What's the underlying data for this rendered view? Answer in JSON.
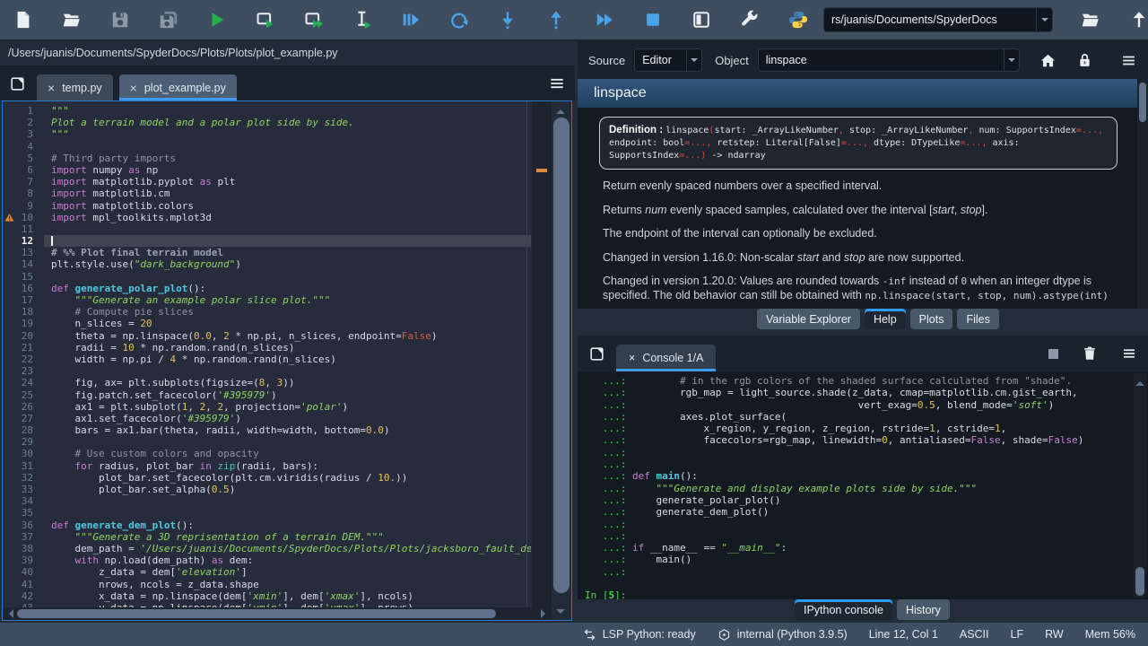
{
  "toolbar": {
    "workdir_value": "rs/juanis/Documents/SpyderDocs",
    "buttons": [
      "new-file",
      "open-file",
      "save",
      "save-all",
      "run-file",
      "run-cell",
      "run-cell-and-advance",
      "run-selection",
      "debug-file",
      "re-run-cell",
      "step-into",
      "step-return",
      "continue",
      "stop",
      "maximize-pane",
      "preferences",
      "python-logo"
    ],
    "right_buttons": [
      "browse-working-directory",
      "parent-directory"
    ]
  },
  "accent": "#3f9bf0",
  "editor": {
    "path": "/Users/juanis/Documents/SpyderDocs/Plots/Plots/plot_example.py",
    "tabs": [
      {
        "label": "temp.py",
        "active": false
      },
      {
        "label": "plot_example.py",
        "active": true
      }
    ],
    "lines": [
      {
        "n": 1,
        "segs": [
          [
            "s",
            "\"\"\""
          ]
        ]
      },
      {
        "n": 2,
        "segs": [
          [
            "s",
            "Plot a terrain model and a polar plot side by side."
          ]
        ]
      },
      {
        "n": 3,
        "segs": [
          [
            "s",
            "\"\"\""
          ]
        ]
      },
      {
        "n": 4,
        "segs": []
      },
      {
        "n": 5,
        "segs": [
          [
            "c",
            "# Third party imports"
          ]
        ]
      },
      {
        "n": 6,
        "segs": [
          [
            "kw",
            "import"
          ],
          [
            "t",
            " numpy "
          ],
          [
            "kw",
            "as"
          ],
          [
            "t",
            " np"
          ]
        ]
      },
      {
        "n": 7,
        "segs": [
          [
            "kw",
            "import"
          ],
          [
            "t",
            " matplotlib.pyplot "
          ],
          [
            "kw",
            "as"
          ],
          [
            "t",
            " plt"
          ]
        ]
      },
      {
        "n": 8,
        "segs": [
          [
            "kw",
            "import"
          ],
          [
            "t",
            " matplotlib.cm"
          ]
        ]
      },
      {
        "n": 9,
        "segs": [
          [
            "kw",
            "import"
          ],
          [
            "t",
            " matplotlib.colors"
          ]
        ]
      },
      {
        "n": 10,
        "warn": true,
        "segs": [
          [
            "kw",
            "import"
          ],
          [
            "t",
            " mpl_toolkits.mplot3d"
          ]
        ]
      },
      {
        "n": 11,
        "segs": []
      },
      {
        "n": 12,
        "cur": true,
        "segs": []
      },
      {
        "n": 13,
        "segs": [
          [
            "cc",
            "# %% Plot final terrain model"
          ]
        ]
      },
      {
        "n": 14,
        "segs": [
          [
            "t",
            "plt.style.use("
          ],
          [
            "s",
            "\"dark_background\""
          ],
          [
            "t",
            ")"
          ]
        ]
      },
      {
        "n": 15,
        "segs": []
      },
      {
        "n": 16,
        "segs": [
          [
            "kw",
            "def"
          ],
          [
            "t",
            " "
          ],
          [
            "d",
            "generate_polar_plot"
          ],
          [
            "t",
            "():"
          ]
        ]
      },
      {
        "n": 17,
        "segs": [
          [
            "t",
            "    "
          ],
          [
            "s",
            "\"\"\"Generate an example polar slice plot.\"\"\""
          ]
        ]
      },
      {
        "n": 18,
        "segs": [
          [
            "t",
            "    "
          ],
          [
            "c",
            "# Compute pie slices"
          ]
        ]
      },
      {
        "n": 19,
        "segs": [
          [
            "t",
            "    n_slices = "
          ],
          [
            "n",
            "20"
          ]
        ]
      },
      {
        "n": 20,
        "segs": [
          [
            "t",
            "    theta = np.linspace("
          ],
          [
            "n",
            "0.0"
          ],
          [
            "t",
            ", "
          ],
          [
            "n",
            "2"
          ],
          [
            "t",
            " * np.pi, n_slices, endpoint="
          ],
          [
            "f",
            "False"
          ],
          [
            "t",
            ")"
          ]
        ]
      },
      {
        "n": 21,
        "segs": [
          [
            "t",
            "    radii = "
          ],
          [
            "n",
            "10"
          ],
          [
            "t",
            " * np.random.rand(n_slices)"
          ]
        ]
      },
      {
        "n": 22,
        "segs": [
          [
            "t",
            "    width = np.pi / "
          ],
          [
            "n",
            "4"
          ],
          [
            "t",
            " * np.random.rand(n_slices)"
          ]
        ]
      },
      {
        "n": 23,
        "segs": []
      },
      {
        "n": 24,
        "segs": [
          [
            "t",
            "    fig, ax= plt.subplots(figsize=("
          ],
          [
            "n",
            "8"
          ],
          [
            "t",
            ", "
          ],
          [
            "n",
            "3"
          ],
          [
            "t",
            "))"
          ]
        ]
      },
      {
        "n": 25,
        "segs": [
          [
            "t",
            "    fig.patch.set_facecolor("
          ],
          [
            "s",
            "'#395979'"
          ],
          [
            "t",
            ")"
          ]
        ]
      },
      {
        "n": 26,
        "segs": [
          [
            "t",
            "    ax1 = plt.subplot("
          ],
          [
            "n",
            "1"
          ],
          [
            "t",
            ", "
          ],
          [
            "n",
            "2"
          ],
          [
            "t",
            ", "
          ],
          [
            "n",
            "2"
          ],
          [
            "t",
            ", projection="
          ],
          [
            "s",
            "'polar'"
          ],
          [
            "t",
            ")"
          ]
        ]
      },
      {
        "n": 27,
        "segs": [
          [
            "t",
            "    ax1.set_facecolor("
          ],
          [
            "s",
            "'#395979'"
          ],
          [
            "t",
            ")"
          ]
        ]
      },
      {
        "n": 28,
        "segs": [
          [
            "t",
            "    bars = ax1.bar(theta, radii, width=width, bottom="
          ],
          [
            "n",
            "0.0"
          ],
          [
            "t",
            ")"
          ]
        ]
      },
      {
        "n": 29,
        "segs": []
      },
      {
        "n": 30,
        "segs": [
          [
            "t",
            "    "
          ],
          [
            "c",
            "# Use custom colors and opacity"
          ]
        ]
      },
      {
        "n": 31,
        "segs": [
          [
            "t",
            "    "
          ],
          [
            "kw",
            "for"
          ],
          [
            "t",
            " radius, plot_bar "
          ],
          [
            "kw",
            "in"
          ],
          [
            "t",
            " "
          ],
          [
            "b",
            "zip"
          ],
          [
            "t",
            "(radii, bars):"
          ]
        ]
      },
      {
        "n": 32,
        "segs": [
          [
            "t",
            "        plot_bar.set_facecolor(plt.cm.viridis(radius / "
          ],
          [
            "n",
            "10."
          ],
          [
            "t",
            "))"
          ]
        ]
      },
      {
        "n": 33,
        "segs": [
          [
            "t",
            "        plot_bar.set_alpha("
          ],
          [
            "n",
            "0.5"
          ],
          [
            "t",
            ")"
          ]
        ]
      },
      {
        "n": 34,
        "segs": []
      },
      {
        "n": 35,
        "segs": []
      },
      {
        "n": 36,
        "segs": [
          [
            "kw",
            "def"
          ],
          [
            "t",
            " "
          ],
          [
            "d",
            "generate_dem_plot"
          ],
          [
            "t",
            "():"
          ]
        ]
      },
      {
        "n": 37,
        "segs": [
          [
            "t",
            "    "
          ],
          [
            "s",
            "\"\"\"Generate a 3D reprisentation of a terrain DEM.\"\"\""
          ]
        ]
      },
      {
        "n": 38,
        "segs": [
          [
            "t",
            "    dem_path = "
          ],
          [
            "s",
            "'/Users/juanis/Documents/SpyderDocs/Plots/Plots/jacksboro_fault_dem.npz'"
          ]
        ]
      },
      {
        "n": 39,
        "segs": [
          [
            "t",
            "    "
          ],
          [
            "kw",
            "with"
          ],
          [
            "t",
            " np.load(dem_path) "
          ],
          [
            "kw",
            "as"
          ],
          [
            "t",
            " dem:"
          ]
        ]
      },
      {
        "n": 40,
        "segs": [
          [
            "t",
            "        z_data = dem["
          ],
          [
            "s",
            "'elevation'"
          ],
          [
            "t",
            "]"
          ]
        ]
      },
      {
        "n": 41,
        "segs": [
          [
            "t",
            "        nrows, ncols = z_data.shape"
          ]
        ]
      },
      {
        "n": 42,
        "segs": [
          [
            "t",
            "        x_data = np.linspace(dem["
          ],
          [
            "s",
            "'xmin'"
          ],
          [
            "t",
            "], dem["
          ],
          [
            "s",
            "'xmax'"
          ],
          [
            "t",
            "], ncols)"
          ]
        ]
      },
      {
        "n": 43,
        "segs": [
          [
            "t",
            "        y_data = np.linspace(dem["
          ],
          [
            "s",
            "'ymin'"
          ],
          [
            "t",
            "], dem["
          ],
          [
            "s",
            "'ymax'"
          ],
          [
            "t",
            "], nrows)"
          ]
        ]
      }
    ]
  },
  "help": {
    "source_label": "Source",
    "source_value": "Editor",
    "object_label": "Object",
    "object_value": "linspace",
    "title": "linspace",
    "definition": [
      [
        "lab",
        "Definition : "
      ],
      [
        "w",
        "linspace"
      ],
      [
        "r",
        "("
      ],
      [
        "w",
        "start: _ArrayLikeNumber"
      ],
      [
        "r",
        ", "
      ],
      [
        "w",
        "stop: _ArrayLikeNumber"
      ],
      [
        "r",
        ", "
      ],
      [
        "w",
        "num: SupportsIndex"
      ],
      [
        "r",
        "=..., "
      ],
      [
        "w",
        "endpoint: bool"
      ],
      [
        "r",
        "=..., "
      ],
      [
        "w",
        "retstep: Literal[False]"
      ],
      [
        "r",
        "=..., "
      ],
      [
        "w",
        "dtype: DTypeLike"
      ],
      [
        "r",
        "=..., "
      ],
      [
        "w",
        "axis: SupportsIndex"
      ],
      [
        "r",
        "=...)"
      ],
      [
        "w",
        " -> ndarray"
      ]
    ],
    "paragraphs": [
      [
        [
          "t",
          "Return evenly spaced numbers over a specified interval."
        ]
      ],
      [
        [
          "t",
          "Returns "
        ],
        [
          "i",
          "num"
        ],
        [
          "t",
          " evenly spaced samples, calculated over the interval ["
        ],
        [
          "i",
          "start"
        ],
        [
          "t",
          ", "
        ],
        [
          "i",
          "stop"
        ],
        [
          "t",
          "]."
        ]
      ],
      [
        [
          "t",
          "The endpoint of the interval can optionally be excluded."
        ]
      ],
      [
        [
          "t",
          "Changed in version 1.16.0: Non-scalar "
        ],
        [
          "i",
          "start"
        ],
        [
          "t",
          " and "
        ],
        [
          "i",
          "stop"
        ],
        [
          "t",
          " are now supported."
        ]
      ],
      [
        [
          "t",
          "Changed in version 1.20.0: Values are rounded towards "
        ],
        [
          "m",
          "-inf"
        ],
        [
          "t",
          " instead of "
        ],
        [
          "m",
          "0"
        ],
        [
          "t",
          " when an integer dtype is specified. The old behavior can still be obtained with "
        ],
        [
          "m",
          "np.linspace(start, stop, num).astype(int)"
        ]
      ]
    ],
    "tabs": [
      {
        "label": "Variable Explorer",
        "active": false
      },
      {
        "label": "Help",
        "active": true
      },
      {
        "label": "Plots",
        "active": false
      },
      {
        "label": "Files",
        "active": false
      }
    ]
  },
  "console": {
    "tab_label": "Console 1/A",
    "lines": [
      {
        "segs": [
          [
            "p",
            "   ...:"
          ],
          [
            "c",
            "         # in the rgb colors of the shaded surface calculated from \"shade\"."
          ]
        ]
      },
      {
        "segs": [
          [
            "p",
            "   ...:"
          ],
          [
            "t",
            "         rgb_map = light_source.shade(z_data, cmap=matplotlib.cm.gist_earth,"
          ]
        ]
      },
      {
        "segs": [
          [
            "p",
            "   ...:"
          ],
          [
            "t",
            "                                       vert_exag="
          ],
          [
            "n",
            "0.5"
          ],
          [
            "t",
            ", blend_mode="
          ],
          [
            "s",
            "'soft'"
          ],
          [
            "t",
            ")"
          ]
        ]
      },
      {
        "segs": [
          [
            "p",
            "   ...:"
          ],
          [
            "t",
            "         axes.plot_surface("
          ]
        ]
      },
      {
        "segs": [
          [
            "p",
            "   ...:"
          ],
          [
            "t",
            "             x_region, y_region, z_region, rstride="
          ],
          [
            "n",
            "1"
          ],
          [
            "t",
            ", cstride="
          ],
          [
            "n",
            "1"
          ],
          [
            "t",
            ","
          ]
        ]
      },
      {
        "segs": [
          [
            "p",
            "   ...:"
          ],
          [
            "t",
            "             facecolors=rgb_map, linewidth="
          ],
          [
            "n",
            "0"
          ],
          [
            "t",
            ", antialiased="
          ],
          [
            "kw",
            "False"
          ],
          [
            "t",
            ", shade="
          ],
          [
            "kw",
            "False"
          ],
          [
            "t",
            ")"
          ]
        ]
      },
      {
        "segs": [
          [
            "p",
            "   ...:"
          ]
        ]
      },
      {
        "segs": [
          [
            "p",
            "   ...:"
          ]
        ]
      },
      {
        "segs": [
          [
            "p",
            "   ...:"
          ],
          [
            "t",
            " "
          ],
          [
            "kw",
            "def"
          ],
          [
            "t",
            " "
          ],
          [
            "d",
            "main"
          ],
          [
            "t",
            "():"
          ]
        ]
      },
      {
        "segs": [
          [
            "p",
            "   ...:"
          ],
          [
            "t",
            "     "
          ],
          [
            "s",
            "\"\"\"Generate and display example plots side by side.\"\"\""
          ]
        ]
      },
      {
        "segs": [
          [
            "p",
            "   ...:"
          ],
          [
            "t",
            "     generate_polar_plot()"
          ]
        ]
      },
      {
        "segs": [
          [
            "p",
            "   ...:"
          ],
          [
            "t",
            "     generate_dem_plot()"
          ]
        ]
      },
      {
        "segs": [
          [
            "p",
            "   ...:"
          ]
        ]
      },
      {
        "segs": [
          [
            "p",
            "   ...:"
          ]
        ]
      },
      {
        "segs": [
          [
            "p",
            "   ...:"
          ],
          [
            "t",
            " "
          ],
          [
            "kw",
            "if"
          ],
          [
            "t",
            " __name__ == "
          ],
          [
            "s",
            "\"__main__\""
          ],
          [
            "t",
            ":"
          ]
        ]
      },
      {
        "segs": [
          [
            "p",
            "   ...:"
          ],
          [
            "t",
            "     main()"
          ]
        ]
      },
      {
        "segs": [
          [
            "p",
            "   ...:"
          ]
        ]
      },
      {
        "segs": []
      },
      {
        "segs": [
          [
            "p",
            "In ["
          ],
          [
            "pb",
            "5"
          ],
          [
            "p",
            "]:"
          ]
        ]
      }
    ],
    "bottom_tabs": [
      {
        "label": "IPython console",
        "active": true
      },
      {
        "label": "History",
        "active": false
      }
    ]
  },
  "statusbar": {
    "items": [
      {
        "icon": "lsp",
        "label": "LSP Python: ready"
      },
      {
        "icon": "env",
        "label": "internal (Python 3.9.5)"
      },
      {
        "label": "Line 12, Col 1"
      },
      {
        "label": "ASCII"
      },
      {
        "label": "LF"
      },
      {
        "label": "RW"
      },
      {
        "label": "Mem 56%"
      }
    ]
  }
}
